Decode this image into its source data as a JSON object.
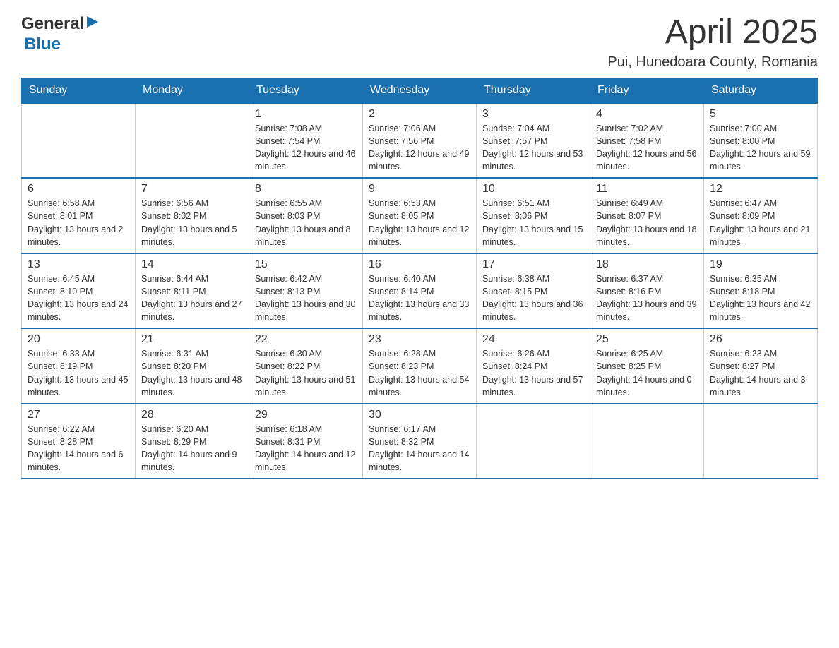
{
  "header": {
    "logo_general": "General",
    "logo_blue": "Blue",
    "month_title": "April 2025",
    "location": "Pui, Hunedoara County, Romania"
  },
  "columns": [
    "Sunday",
    "Monday",
    "Tuesday",
    "Wednesday",
    "Thursday",
    "Friday",
    "Saturday"
  ],
  "weeks": [
    [
      {
        "day": "",
        "sunrise": "",
        "sunset": "",
        "daylight": ""
      },
      {
        "day": "",
        "sunrise": "",
        "sunset": "",
        "daylight": ""
      },
      {
        "day": "1",
        "sunrise": "Sunrise: 7:08 AM",
        "sunset": "Sunset: 7:54 PM",
        "daylight": "Daylight: 12 hours and 46 minutes."
      },
      {
        "day": "2",
        "sunrise": "Sunrise: 7:06 AM",
        "sunset": "Sunset: 7:56 PM",
        "daylight": "Daylight: 12 hours and 49 minutes."
      },
      {
        "day": "3",
        "sunrise": "Sunrise: 7:04 AM",
        "sunset": "Sunset: 7:57 PM",
        "daylight": "Daylight: 12 hours and 53 minutes."
      },
      {
        "day": "4",
        "sunrise": "Sunrise: 7:02 AM",
        "sunset": "Sunset: 7:58 PM",
        "daylight": "Daylight: 12 hours and 56 minutes."
      },
      {
        "day": "5",
        "sunrise": "Sunrise: 7:00 AM",
        "sunset": "Sunset: 8:00 PM",
        "daylight": "Daylight: 12 hours and 59 minutes."
      }
    ],
    [
      {
        "day": "6",
        "sunrise": "Sunrise: 6:58 AM",
        "sunset": "Sunset: 8:01 PM",
        "daylight": "Daylight: 13 hours and 2 minutes."
      },
      {
        "day": "7",
        "sunrise": "Sunrise: 6:56 AM",
        "sunset": "Sunset: 8:02 PM",
        "daylight": "Daylight: 13 hours and 5 minutes."
      },
      {
        "day": "8",
        "sunrise": "Sunrise: 6:55 AM",
        "sunset": "Sunset: 8:03 PM",
        "daylight": "Daylight: 13 hours and 8 minutes."
      },
      {
        "day": "9",
        "sunrise": "Sunrise: 6:53 AM",
        "sunset": "Sunset: 8:05 PM",
        "daylight": "Daylight: 13 hours and 12 minutes."
      },
      {
        "day": "10",
        "sunrise": "Sunrise: 6:51 AM",
        "sunset": "Sunset: 8:06 PM",
        "daylight": "Daylight: 13 hours and 15 minutes."
      },
      {
        "day": "11",
        "sunrise": "Sunrise: 6:49 AM",
        "sunset": "Sunset: 8:07 PM",
        "daylight": "Daylight: 13 hours and 18 minutes."
      },
      {
        "day": "12",
        "sunrise": "Sunrise: 6:47 AM",
        "sunset": "Sunset: 8:09 PM",
        "daylight": "Daylight: 13 hours and 21 minutes."
      }
    ],
    [
      {
        "day": "13",
        "sunrise": "Sunrise: 6:45 AM",
        "sunset": "Sunset: 8:10 PM",
        "daylight": "Daylight: 13 hours and 24 minutes."
      },
      {
        "day": "14",
        "sunrise": "Sunrise: 6:44 AM",
        "sunset": "Sunset: 8:11 PM",
        "daylight": "Daylight: 13 hours and 27 minutes."
      },
      {
        "day": "15",
        "sunrise": "Sunrise: 6:42 AM",
        "sunset": "Sunset: 8:13 PM",
        "daylight": "Daylight: 13 hours and 30 minutes."
      },
      {
        "day": "16",
        "sunrise": "Sunrise: 6:40 AM",
        "sunset": "Sunset: 8:14 PM",
        "daylight": "Daylight: 13 hours and 33 minutes."
      },
      {
        "day": "17",
        "sunrise": "Sunrise: 6:38 AM",
        "sunset": "Sunset: 8:15 PM",
        "daylight": "Daylight: 13 hours and 36 minutes."
      },
      {
        "day": "18",
        "sunrise": "Sunrise: 6:37 AM",
        "sunset": "Sunset: 8:16 PM",
        "daylight": "Daylight: 13 hours and 39 minutes."
      },
      {
        "day": "19",
        "sunrise": "Sunrise: 6:35 AM",
        "sunset": "Sunset: 8:18 PM",
        "daylight": "Daylight: 13 hours and 42 minutes."
      }
    ],
    [
      {
        "day": "20",
        "sunrise": "Sunrise: 6:33 AM",
        "sunset": "Sunset: 8:19 PM",
        "daylight": "Daylight: 13 hours and 45 minutes."
      },
      {
        "day": "21",
        "sunrise": "Sunrise: 6:31 AM",
        "sunset": "Sunset: 8:20 PM",
        "daylight": "Daylight: 13 hours and 48 minutes."
      },
      {
        "day": "22",
        "sunrise": "Sunrise: 6:30 AM",
        "sunset": "Sunset: 8:22 PM",
        "daylight": "Daylight: 13 hours and 51 minutes."
      },
      {
        "day": "23",
        "sunrise": "Sunrise: 6:28 AM",
        "sunset": "Sunset: 8:23 PM",
        "daylight": "Daylight: 13 hours and 54 minutes."
      },
      {
        "day": "24",
        "sunrise": "Sunrise: 6:26 AM",
        "sunset": "Sunset: 8:24 PM",
        "daylight": "Daylight: 13 hours and 57 minutes."
      },
      {
        "day": "25",
        "sunrise": "Sunrise: 6:25 AM",
        "sunset": "Sunset: 8:25 PM",
        "daylight": "Daylight: 14 hours and 0 minutes."
      },
      {
        "day": "26",
        "sunrise": "Sunrise: 6:23 AM",
        "sunset": "Sunset: 8:27 PM",
        "daylight": "Daylight: 14 hours and 3 minutes."
      }
    ],
    [
      {
        "day": "27",
        "sunrise": "Sunrise: 6:22 AM",
        "sunset": "Sunset: 8:28 PM",
        "daylight": "Daylight: 14 hours and 6 minutes."
      },
      {
        "day": "28",
        "sunrise": "Sunrise: 6:20 AM",
        "sunset": "Sunset: 8:29 PM",
        "daylight": "Daylight: 14 hours and 9 minutes."
      },
      {
        "day": "29",
        "sunrise": "Sunrise: 6:18 AM",
        "sunset": "Sunset: 8:31 PM",
        "daylight": "Daylight: 14 hours and 12 minutes."
      },
      {
        "day": "30",
        "sunrise": "Sunrise: 6:17 AM",
        "sunset": "Sunset: 8:32 PM",
        "daylight": "Daylight: 14 hours and 14 minutes."
      },
      {
        "day": "",
        "sunrise": "",
        "sunset": "",
        "daylight": ""
      },
      {
        "day": "",
        "sunrise": "",
        "sunset": "",
        "daylight": ""
      },
      {
        "day": "",
        "sunrise": "",
        "sunset": "",
        "daylight": ""
      }
    ]
  ]
}
